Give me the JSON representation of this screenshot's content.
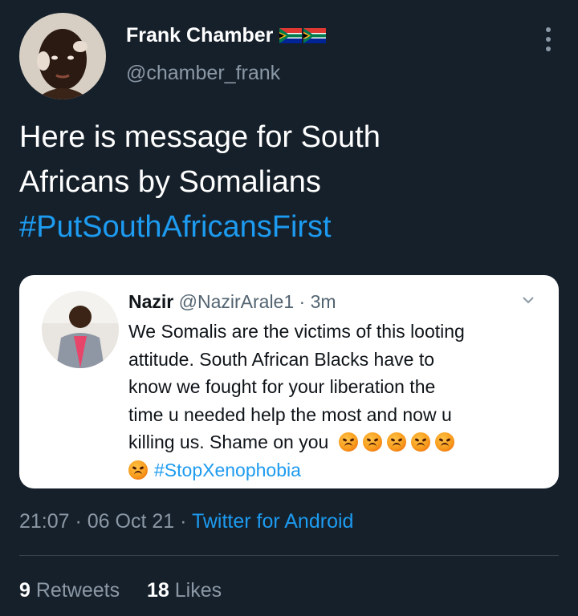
{
  "tweet": {
    "author": {
      "display_name": "Frank Chamber",
      "handle": "@chamber_frank",
      "flags": [
        "south-africa-flag",
        "south-africa-flag"
      ]
    },
    "text_lines": [
      "Here is message for South",
      "Africans by Somalians"
    ],
    "hashtag": "#PutSouthAfricansFirst",
    "more_icon": "more-vertical-icon"
  },
  "quoted_tweet": {
    "name": "Nazir",
    "handle": "@NazirArale1",
    "separator": "·",
    "time": "3m",
    "lines": [
      "We Somalis are the victims of this looting",
      "attitude.  South African Blacks have to",
      "know we fought for your  liberation the",
      "time u needed help the most and now u",
      "killing us. Shame on you"
    ],
    "emojis": [
      "angry-face-emoji",
      "angry-face-emoji",
      "angry-face-emoji",
      "angry-face-emoji",
      "angry-face-emoji",
      "angry-face-emoji"
    ],
    "hashtag": "#StopXenophobia",
    "chevron_icon": "chevron-down-icon"
  },
  "meta": {
    "time": "21:07",
    "separator": " · ",
    "date": "06 Oct 21",
    "source": "Twitter for Android"
  },
  "stats": {
    "retweets_count": "9",
    "retweets_label": "Retweets",
    "likes_count": "18",
    "likes_label": "Likes"
  },
  "colors": {
    "background": "#15202b",
    "accent": "#1d9bf0",
    "secondary_text": "#8b98a5"
  }
}
